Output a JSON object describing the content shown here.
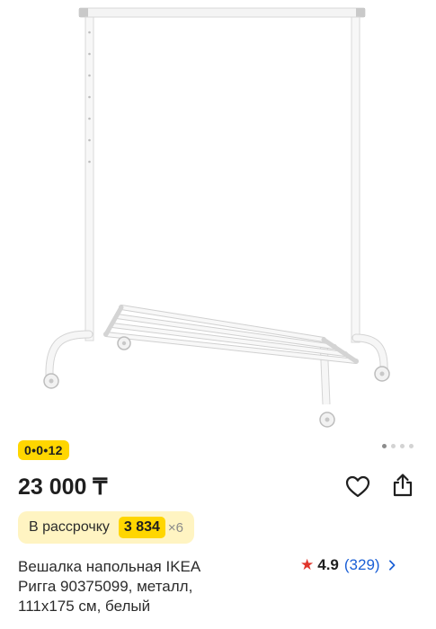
{
  "product": {
    "image_alt": "Напольная вешалка",
    "installment_badge": "0•0•12",
    "gallery": {
      "total_images": 4,
      "active_index": 0
    },
    "price": "23 000 ₸",
    "installment": {
      "label": "В рассрочку",
      "amount": "3 834",
      "multiplier": "×6"
    },
    "title_lines": [
      "Вешалка напольная IKEA",
      "Ригга 90375099, металл,",
      "111x175 см, белый"
    ],
    "rating": {
      "score": "4.9",
      "count": "(329)"
    }
  },
  "icons": {
    "favorite": "heart-icon",
    "share": "share-icon",
    "rating_star": "star-icon",
    "rating_more": "chevron-right-icon"
  },
  "colors": {
    "badge_yellow": "#ffd600",
    "pill_bg": "#fff4c2",
    "link_blue": "#1a5fd6",
    "star_red": "#e0352b"
  }
}
